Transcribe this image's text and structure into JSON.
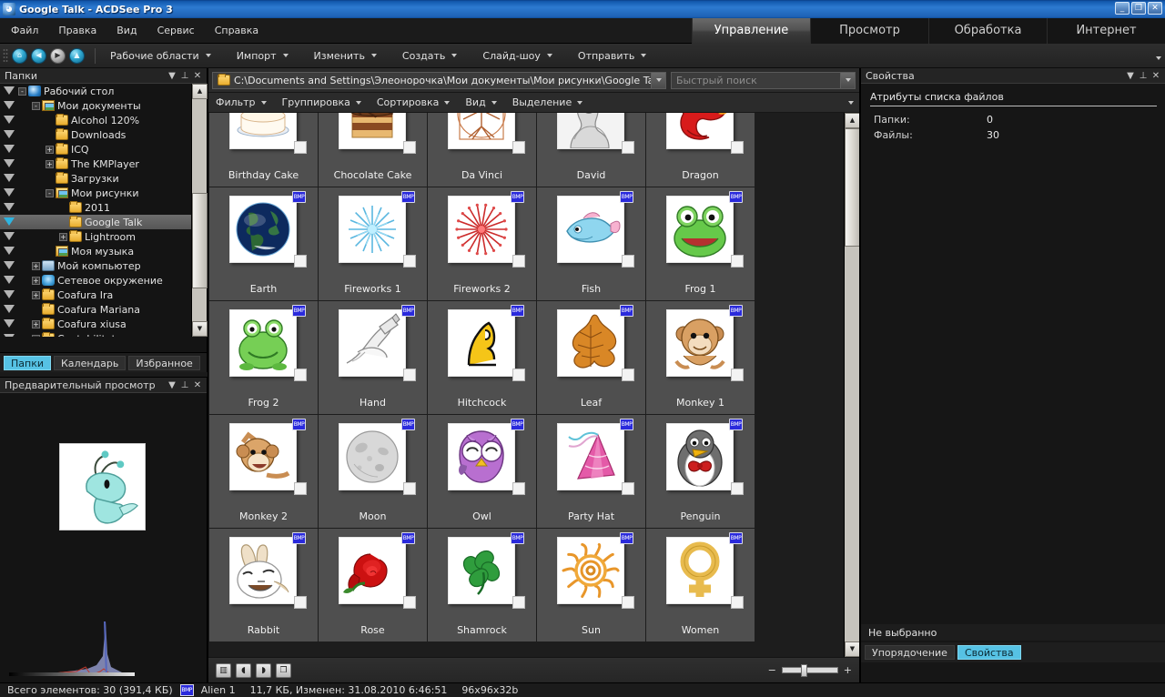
{
  "window": {
    "title": "Google Talk - ACDSee Pro 3",
    "icon": "app-icon",
    "buttons": {
      "minimize": "_",
      "restore": "❐",
      "close": "✕"
    }
  },
  "menubar": {
    "items": [
      "Файл",
      "Правка",
      "Вид",
      "Сервис",
      "Справка"
    ]
  },
  "mode_tabs": [
    {
      "label": "Управление",
      "active": true
    },
    {
      "label": "Просмотр",
      "active": false
    },
    {
      "label": "Обработка",
      "active": false
    },
    {
      "label": "Интернет",
      "active": false
    }
  ],
  "toolbar": {
    "icons": [
      "home-icon",
      "back-icon",
      "forward-icon",
      "up-icon"
    ],
    "buttons": [
      {
        "label": "Рабочие области",
        "has_caret": true
      },
      {
        "label": "Импорт",
        "has_caret": true
      },
      {
        "label": "Изменить",
        "has_caret": true
      },
      {
        "label": "Создать",
        "has_caret": true
      },
      {
        "label": "Слайд-шоу",
        "has_caret": true
      },
      {
        "label": "Отправить",
        "has_caret": true
      }
    ],
    "overflow": "chevron-down-icon"
  },
  "folders_panel": {
    "title": "Папки",
    "header_icons": [
      "chevron-down-icon",
      "pin-icon",
      "close-icon"
    ],
    "tree": [
      {
        "label": "Рабочий стол",
        "indent": 0,
        "expander": "-",
        "icon": "desktop-icon",
        "checked": false,
        "selected": false
      },
      {
        "label": "Мои документы",
        "indent": 1,
        "expander": "-",
        "icon": "pictures-icon",
        "checked": false,
        "selected": false
      },
      {
        "label": "Alcohol 120%",
        "indent": 2,
        "expander": "",
        "icon": "folder-icon",
        "checked": false,
        "selected": false
      },
      {
        "label": "Downloads",
        "indent": 2,
        "expander": "",
        "icon": "folder-icon",
        "checked": false,
        "selected": false
      },
      {
        "label": "ICQ",
        "indent": 2,
        "expander": "+",
        "icon": "folder-icon",
        "checked": false,
        "selected": false
      },
      {
        "label": "The KMPlayer",
        "indent": 2,
        "expander": "+",
        "icon": "folder-icon",
        "checked": false,
        "selected": false
      },
      {
        "label": "Загрузки",
        "indent": 2,
        "expander": "",
        "icon": "folder-icon",
        "checked": false,
        "selected": false
      },
      {
        "label": "Мои рисунки",
        "indent": 2,
        "expander": "-",
        "icon": "pictures-icon",
        "checked": false,
        "selected": false
      },
      {
        "label": "2011",
        "indent": 3,
        "expander": "",
        "icon": "folder-icon",
        "checked": false,
        "selected": false
      },
      {
        "label": "Google Talk",
        "indent": 3,
        "expander": "",
        "icon": "folder-icon",
        "checked": true,
        "selected": true
      },
      {
        "label": "Lightroom",
        "indent": 3,
        "expander": "+",
        "icon": "folder-icon",
        "checked": false,
        "selected": false
      },
      {
        "label": "Моя музыка",
        "indent": 2,
        "expander": "",
        "icon": "music-icon",
        "checked": false,
        "selected": false
      },
      {
        "label": "Мой компьютер",
        "indent": 1,
        "expander": "+",
        "icon": "computer-icon",
        "checked": false,
        "selected": false
      },
      {
        "label": "Сетевое окружение",
        "indent": 1,
        "expander": "+",
        "icon": "network-icon",
        "checked": false,
        "selected": false
      },
      {
        "label": "Coafura Ira",
        "indent": 1,
        "expander": "+",
        "icon": "folder-icon",
        "checked": false,
        "selected": false
      },
      {
        "label": "Coafura Mariana",
        "indent": 1,
        "expander": "",
        "icon": "folder-icon",
        "checked": false,
        "selected": false
      },
      {
        "label": "Coafura xiusa",
        "indent": 1,
        "expander": "+",
        "icon": "folder-icon",
        "checked": false,
        "selected": false
      },
      {
        "label": "Contabilitate",
        "indent": 1,
        "expander": "+",
        "icon": "folder-icon",
        "checked": false,
        "selected": false
      }
    ],
    "tabs": [
      {
        "label": "Папки",
        "active": true
      },
      {
        "label": "Календарь",
        "active": false
      },
      {
        "label": "Избранное",
        "active": false
      }
    ]
  },
  "preview_panel": {
    "title": "Предварительный просмотр",
    "header_icons": [
      "chevron-down-icon",
      "pin-icon",
      "close-icon"
    ],
    "image_alt": "Alien 1"
  },
  "address_bar": {
    "path": "C:\\Documents and Settings\\Элеонорочка\\Мои документы\\Мои рисунки\\Google Talk",
    "dropdown": "chevron-down-icon",
    "search_placeholder": "Быстрый поиск"
  },
  "filter_bar": {
    "buttons": [
      {
        "label": "Фильтр",
        "has_caret": true
      },
      {
        "label": "Группировка",
        "has_caret": true
      },
      {
        "label": "Сортировка",
        "has_caret": true
      },
      {
        "label": "Вид",
        "has_caret": true
      },
      {
        "label": "Выделение",
        "has_caret": true
      }
    ],
    "overflow": "chevron-down-icon"
  },
  "thumbnails": {
    "badge_label": "BMP",
    "items": [
      {
        "name": "Birthday Cake",
        "art": "birthday-cake"
      },
      {
        "name": "Chocolate Cake",
        "art": "chocolate-cake"
      },
      {
        "name": "Da Vinci",
        "art": "da-vinci"
      },
      {
        "name": "David",
        "art": "david"
      },
      {
        "name": "Dragon",
        "art": "dragon"
      },
      {
        "name": "Earth",
        "art": "earth"
      },
      {
        "name": "Fireworks 1",
        "art": "fireworks-1"
      },
      {
        "name": "Fireworks 2",
        "art": "fireworks-2"
      },
      {
        "name": "Fish",
        "art": "fish"
      },
      {
        "name": "Frog 1",
        "art": "frog-1"
      },
      {
        "name": "Frog 2",
        "art": "frog-2"
      },
      {
        "name": "Hand",
        "art": "hand"
      },
      {
        "name": "Hitchcock",
        "art": "hitchcock"
      },
      {
        "name": "Leaf",
        "art": "leaf"
      },
      {
        "name": "Monkey 1",
        "art": "monkey-1"
      },
      {
        "name": "Monkey 2",
        "art": "monkey-2"
      },
      {
        "name": "Moon",
        "art": "moon"
      },
      {
        "name": "Owl",
        "art": "owl"
      },
      {
        "name": "Party Hat",
        "art": "party-hat"
      },
      {
        "name": "Penguin",
        "art": "penguin"
      },
      {
        "name": "Rabbit",
        "art": "rabbit"
      },
      {
        "name": "Rose",
        "art": "rose"
      },
      {
        "name": "Shamrock",
        "art": "shamrock"
      },
      {
        "name": "Sun",
        "art": "sun"
      },
      {
        "name": "Women",
        "art": "women"
      }
    ]
  },
  "bottom_bar": {
    "icons": [
      "image-properties-icon",
      "rotate-left-icon",
      "rotate-right-icon",
      "duplicate-icon"
    ],
    "zoom_minus": "−",
    "zoom_plus": "+"
  },
  "properties_panel": {
    "title": "Свойства",
    "header_icons": [
      "chevron-down-icon",
      "pin-icon",
      "close-icon"
    ],
    "section_title": "Атрибуты списка файлов",
    "rows": [
      {
        "label": "Папки:",
        "value": "0"
      },
      {
        "label": "Файлы:",
        "value": "30"
      }
    ],
    "not_selected": "Не выбранно",
    "tabs": [
      {
        "label": "Упорядочение",
        "active": false
      },
      {
        "label": "Свойства",
        "active": true
      }
    ]
  },
  "status_bar": {
    "total": "Всего элементов: 30  (391,4 КБ)",
    "file_badge": "BMP",
    "file_name": "Alien 1",
    "file_info": "11,7 КБ, Изменен: 31.08.2010 6:46:51",
    "dimensions": "96x96x32b"
  },
  "colors": {
    "titlebar_blue": "#1f66bb",
    "panel_bg": "#1a1a1a",
    "cell_bg": "#4f4f4f",
    "accent_cyan": "#56c2e4",
    "badge_blue": "#2a2adc"
  }
}
